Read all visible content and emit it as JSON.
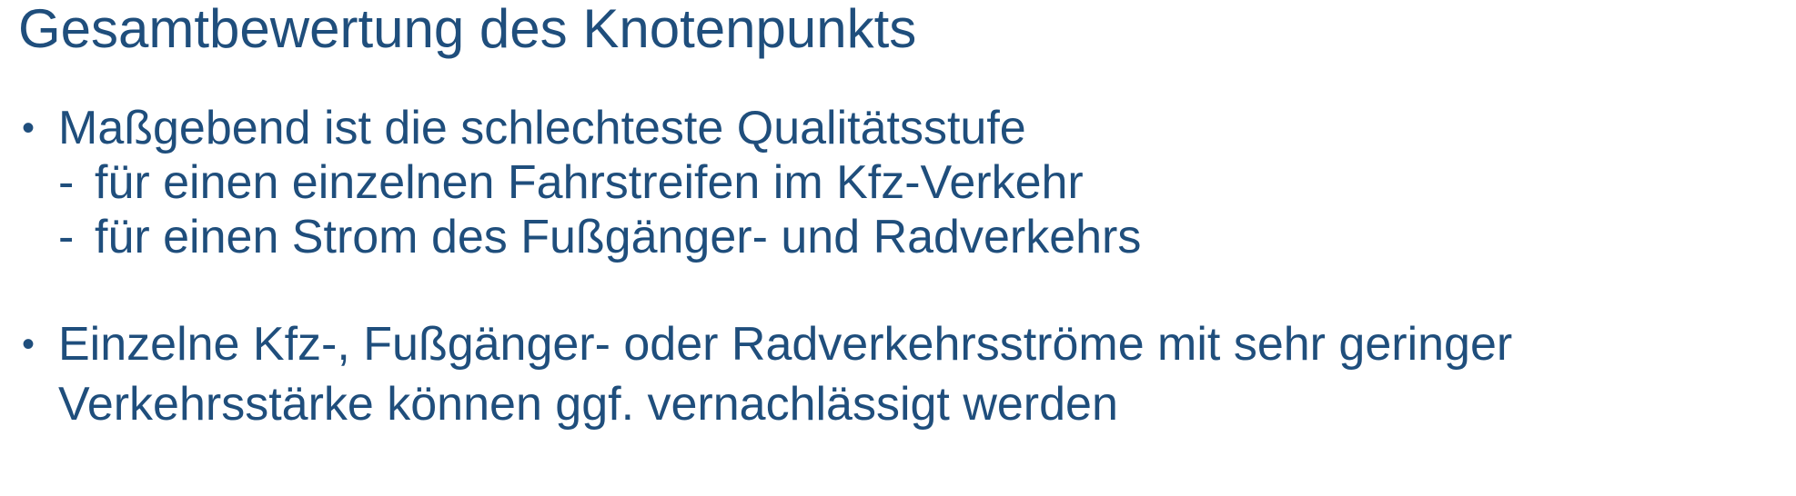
{
  "slide": {
    "title": "Gesamtbewertung des Knotenpunkts",
    "bullets": [
      {
        "marker": "•",
        "text": "Maßgebend ist die schlechteste Qualitätsstufe",
        "subitems": [
          {
            "marker": "-",
            "text": "für einen einzelnen Fahrstreifen im Kfz-Verkehr"
          },
          {
            "marker": "-",
            "text": "für einen Strom des Fußgänger- und Radverkehrs"
          }
        ]
      },
      {
        "marker": "•",
        "lines": [
          "Einzelne Kfz-, Fußgänger- oder Radverkehrsströme mit sehr geringer",
          "Verkehrsstärke können ggf. vernachlässigt werden"
        ]
      }
    ]
  },
  "colors": {
    "text": "#1f4e7c",
    "background": "#ffffff"
  }
}
